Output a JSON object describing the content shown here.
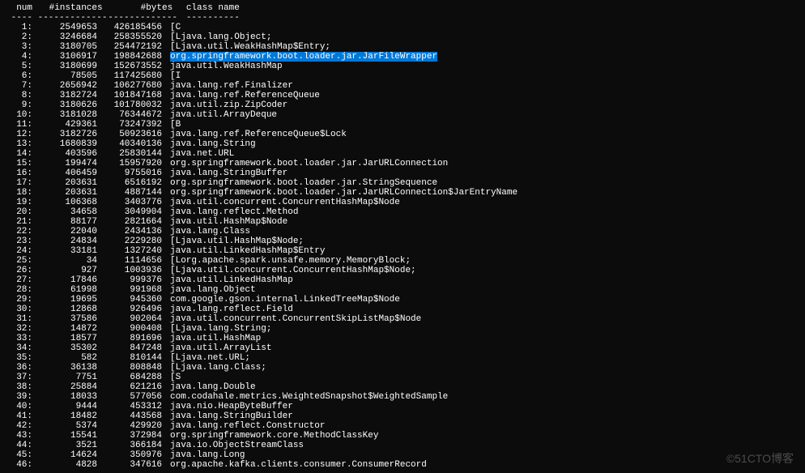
{
  "header": {
    "num": " num",
    "instances": "#instances",
    "bytes": "#bytes",
    "classname": "class name"
  },
  "watermark": "©51CTO博客",
  "rows": [
    {
      "num": "1:",
      "instances": "2549653",
      "bytes": "426185456",
      "classname": "[C",
      "hl": false
    },
    {
      "num": "2:",
      "instances": "3246684",
      "bytes": "258355520",
      "classname": "[Ljava.lang.Object;",
      "hl": false
    },
    {
      "num": "3:",
      "instances": "3180705",
      "bytes": "254472192",
      "classname": "[Ljava.util.WeakHashMap$Entry;",
      "hl": false
    },
    {
      "num": "4:",
      "instances": "3106917",
      "bytes": "198842688",
      "classname": "org.springframework.boot.loader.jar.JarFileWrapper",
      "hl": true
    },
    {
      "num": "5:",
      "instances": "3180699",
      "bytes": "152673552",
      "classname": "java.util.WeakHashMap",
      "hl": false
    },
    {
      "num": "6:",
      "instances": "78505",
      "bytes": "117425680",
      "classname": "[I",
      "hl": false
    },
    {
      "num": "7:",
      "instances": "2656942",
      "bytes": "106277680",
      "classname": "java.lang.ref.Finalizer",
      "hl": false
    },
    {
      "num": "8:",
      "instances": "3182724",
      "bytes": "101847168",
      "classname": "java.lang.ref.ReferenceQueue",
      "hl": false
    },
    {
      "num": "9:",
      "instances": "3180626",
      "bytes": "101780032",
      "classname": "java.util.zip.ZipCoder",
      "hl": false
    },
    {
      "num": "10:",
      "instances": "3181028",
      "bytes": "76344672",
      "classname": "java.util.ArrayDeque",
      "hl": false
    },
    {
      "num": "11:",
      "instances": "429361",
      "bytes": "73247392",
      "classname": "[B",
      "hl": false
    },
    {
      "num": "12:",
      "instances": "3182726",
      "bytes": "50923616",
      "classname": "java.lang.ref.ReferenceQueue$Lock",
      "hl": false
    },
    {
      "num": "13:",
      "instances": "1680839",
      "bytes": "40340136",
      "classname": "java.lang.String",
      "hl": false
    },
    {
      "num": "14:",
      "instances": "403596",
      "bytes": "25830144",
      "classname": "java.net.URL",
      "hl": false
    },
    {
      "num": "15:",
      "instances": "199474",
      "bytes": "15957920",
      "classname": "org.springframework.boot.loader.jar.JarURLConnection",
      "hl": false
    },
    {
      "num": "16:",
      "instances": "406459",
      "bytes": "9755016",
      "classname": "java.lang.StringBuffer",
      "hl": false
    },
    {
      "num": "17:",
      "instances": "203631",
      "bytes": "6516192",
      "classname": "org.springframework.boot.loader.jar.StringSequence",
      "hl": false
    },
    {
      "num": "18:",
      "instances": "203631",
      "bytes": "4887144",
      "classname": "org.springframework.boot.loader.jar.JarURLConnection$JarEntryName",
      "hl": false
    },
    {
      "num": "19:",
      "instances": "106368",
      "bytes": "3403776",
      "classname": "java.util.concurrent.ConcurrentHashMap$Node",
      "hl": false
    },
    {
      "num": "20:",
      "instances": "34658",
      "bytes": "3049904",
      "classname": "java.lang.reflect.Method",
      "hl": false
    },
    {
      "num": "21:",
      "instances": "88177",
      "bytes": "2821664",
      "classname": "java.util.HashMap$Node",
      "hl": false
    },
    {
      "num": "22:",
      "instances": "22040",
      "bytes": "2434136",
      "classname": "java.lang.Class",
      "hl": false
    },
    {
      "num": "23:",
      "instances": "24834",
      "bytes": "2229280",
      "classname": "[Ljava.util.HashMap$Node;",
      "hl": false
    },
    {
      "num": "24:",
      "instances": "33181",
      "bytes": "1327240",
      "classname": "java.util.LinkedHashMap$Entry",
      "hl": false
    },
    {
      "num": "25:",
      "instances": "34",
      "bytes": "1114656",
      "classname": "[Lorg.apache.spark.unsafe.memory.MemoryBlock;",
      "hl": false
    },
    {
      "num": "26:",
      "instances": "927",
      "bytes": "1003936",
      "classname": "[Ljava.util.concurrent.ConcurrentHashMap$Node;",
      "hl": false
    },
    {
      "num": "27:",
      "instances": "17846",
      "bytes": "999376",
      "classname": "java.util.LinkedHashMap",
      "hl": false
    },
    {
      "num": "28:",
      "instances": "61998",
      "bytes": "991968",
      "classname": "java.lang.Object",
      "hl": false
    },
    {
      "num": "29:",
      "instances": "19695",
      "bytes": "945360",
      "classname": "com.google.gson.internal.LinkedTreeMap$Node",
      "hl": false
    },
    {
      "num": "30:",
      "instances": "12868",
      "bytes": "926496",
      "classname": "java.lang.reflect.Field",
      "hl": false
    },
    {
      "num": "31:",
      "instances": "37586",
      "bytes": "902064",
      "classname": "java.util.concurrent.ConcurrentSkipListMap$Node",
      "hl": false
    },
    {
      "num": "32:",
      "instances": "14872",
      "bytes": "900408",
      "classname": "[Ljava.lang.String;",
      "hl": false
    },
    {
      "num": "33:",
      "instances": "18577",
      "bytes": "891696",
      "classname": "java.util.HashMap",
      "hl": false
    },
    {
      "num": "34:",
      "instances": "35302",
      "bytes": "847248",
      "classname": "java.util.ArrayList",
      "hl": false
    },
    {
      "num": "35:",
      "instances": "582",
      "bytes": "810144",
      "classname": "[Ljava.net.URL;",
      "hl": false
    },
    {
      "num": "36:",
      "instances": "36138",
      "bytes": "808848",
      "classname": "[Ljava.lang.Class;",
      "hl": false
    },
    {
      "num": "37:",
      "instances": "7751",
      "bytes": "684288",
      "classname": "[S",
      "hl": false
    },
    {
      "num": "38:",
      "instances": "25884",
      "bytes": "621216",
      "classname": "java.lang.Double",
      "hl": false
    },
    {
      "num": "39:",
      "instances": "18033",
      "bytes": "577056",
      "classname": "com.codahale.metrics.WeightedSnapshot$WeightedSample",
      "hl": false
    },
    {
      "num": "40:",
      "instances": "9444",
      "bytes": "453312",
      "classname": "java.nio.HeapByteBuffer",
      "hl": false
    },
    {
      "num": "41:",
      "instances": "18482",
      "bytes": "443568",
      "classname": "java.lang.StringBuilder",
      "hl": false
    },
    {
      "num": "42:",
      "instances": "5374",
      "bytes": "429920",
      "classname": "java.lang.reflect.Constructor",
      "hl": false
    },
    {
      "num": "43:",
      "instances": "15541",
      "bytes": "372984",
      "classname": "org.springframework.core.MethodClassKey",
      "hl": false
    },
    {
      "num": "44:",
      "instances": "3521",
      "bytes": "366184",
      "classname": "java.io.ObjectStreamClass",
      "hl": false
    },
    {
      "num": "45:",
      "instances": "14624",
      "bytes": "350976",
      "classname": "java.lang.Long",
      "hl": false
    },
    {
      "num": "46:",
      "instances": "4828",
      "bytes": "347616",
      "classname": "org.apache.kafka.clients.consumer.ConsumerRecord",
      "hl": false
    }
  ]
}
